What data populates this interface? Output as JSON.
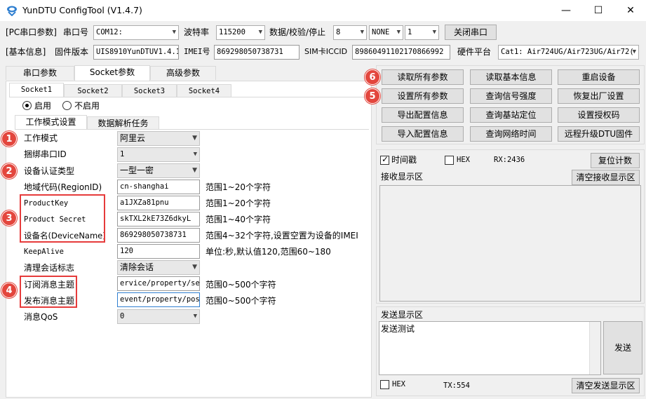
{
  "window": {
    "title": "YunDTU ConfigTool (V1.4.7)",
    "minimize": "—",
    "maximize": "☐",
    "close": "✕"
  },
  "serial": {
    "section_label": "[PC串口参数]",
    "port_label": "串口号",
    "port_value": "COM12:",
    "baud_label": "波特率",
    "baud_value": "115200",
    "format_label": "数据/校验/停止",
    "data_bits": "8",
    "parity": "NONE",
    "stop_bits": "1",
    "close_button": "关闭串口"
  },
  "basic": {
    "section_label": "[基本信息]",
    "firmware_label": "固件版本",
    "firmware_value": "UIS8910YunDTUV1.4.1",
    "imei_label": "IMEI号",
    "imei_value": "869298050738731",
    "iccid_label": "SIM卡ICCID",
    "iccid_value": "89860491102170866992",
    "platform_label": "硬件平台",
    "platform_value": "Cat1: Air724UG/Air723UG/Air72("
  },
  "main_tabs": [
    "串口参数",
    "Socket参数",
    "高级参数"
  ],
  "socket_tabs": [
    "Socket1",
    "Socket2",
    "Socket3",
    "Socket4"
  ],
  "enable": {
    "on_label": "启用",
    "off_label": "不启用"
  },
  "sub_tabs": [
    "工作模式设置",
    "数据解析任务"
  ],
  "form": {
    "work_mode_label": "工作模式",
    "work_mode_value": "阿里云",
    "bind_serial_label": "捆绑串口ID",
    "bind_serial_value": "1",
    "auth_type_label": "设备认证类型",
    "auth_type_value": "一型一密",
    "region_label": "地域代码(RegionID)",
    "region_value": "cn-shanghai",
    "region_hint": "范围1~20个字符",
    "product_key_label": "ProductKey",
    "product_key_value": "a1JXZa81pnu",
    "product_key_hint": "范围1~20个字符",
    "product_secret_label": "Product Secret",
    "product_secret_value": "skTXL2kE73Z6dkyL",
    "product_secret_hint": "范围1~40个字符",
    "device_name_label": "设备名(DeviceName)",
    "device_name_value": "869298050738731",
    "device_name_hint": "范围4~32个字符,设置空置为设备的IMEI",
    "keepalive_label": "KeepAlive",
    "keepalive_value": "120",
    "keepalive_hint": "单位:秒,默认值120,范围60~180",
    "clean_session_label": "清理会话标志",
    "clean_session_value": "清除会话",
    "sub_topic_label": "订阅消息主题",
    "sub_topic_value": "ervice/property/set",
    "sub_topic_hint": "范围0~500个字符",
    "pub_topic_label": "发布消息主题",
    "pub_topic_value": "event/property/post",
    "pub_topic_hint": "范围0~500个字符",
    "qos_label": "消息QoS",
    "qos_value": "0"
  },
  "badges": {
    "b1": "1",
    "b2": "2",
    "b3": "3",
    "b4": "4",
    "b5": "5",
    "b6": "6"
  },
  "actions": {
    "read_all": "读取所有参数",
    "read_basic": "读取基本信息",
    "restart": "重启设备",
    "set_all": "设置所有参数",
    "query_signal": "查询信号强度",
    "factory_reset": "恢复出厂设置",
    "export_config": "导出配置信息",
    "query_location": "查询基站定位",
    "set_auth_code": "设置授权码",
    "import_config": "导入配置信息",
    "query_time": "查询网络时间",
    "remote_upgrade": "远程升级DTU固件"
  },
  "receive": {
    "timestamp_label": "时间戳",
    "hex_label": "HEX",
    "rx_label": "RX:2436",
    "reset_count": "复位计数",
    "area_label": "接收显示区",
    "clear_button": "清空接收显示区"
  },
  "send": {
    "area_label": "发送显示区",
    "text": "发送测试",
    "send_button": "发送",
    "hex_label": "HEX",
    "tx_label": "TX:554",
    "clear_button": "清空发送显示区"
  },
  "colors": {
    "accent_red": "#e3463d",
    "frame_red": "#e63b3b"
  }
}
